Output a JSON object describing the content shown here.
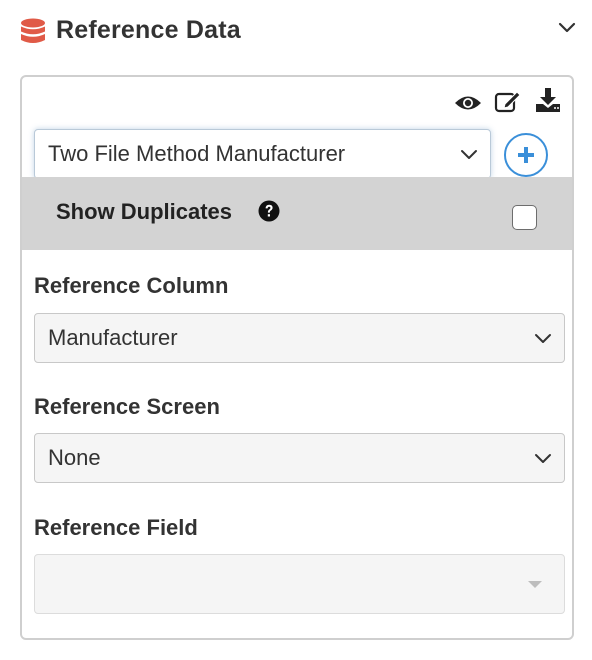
{
  "header": {
    "title": "Reference Data",
    "icon": "database-icon",
    "icon_color": "#e05a47",
    "collapse_icon": "chevron-down-icon"
  },
  "toolbar": {
    "icons": [
      "eye-icon",
      "edit-icon",
      "download-icon"
    ]
  },
  "method_select": {
    "value": "Two File Method Manufacturer",
    "add_icon": "plus-circle-icon",
    "accent_color": "#3a8fd9"
  },
  "duplicates": {
    "label": "Show Duplicates",
    "help_icon": "question-circle-icon",
    "checked": false,
    "bar_color": "#d3d3d3"
  },
  "reference_column": {
    "label": "Reference Column",
    "value": "Manufacturer"
  },
  "reference_screen": {
    "label": "Reference Screen",
    "value": "None"
  },
  "reference_field": {
    "label": "Reference Field",
    "value": "",
    "disabled": true
  }
}
